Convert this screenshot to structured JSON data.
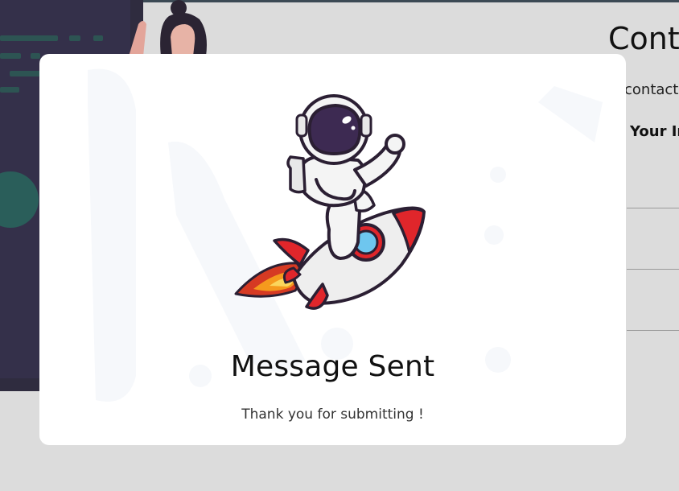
{
  "background": {
    "contact_title": "Conta",
    "contact_subtitle": "contact",
    "contact_section_label": "Your In"
  },
  "modal": {
    "title": "Message Sent",
    "message": "Thank you for submitting !",
    "illustration": "astronaut-on-rocket"
  },
  "colors": {
    "overlay": "#dcdcdc",
    "modal_bg": "#ffffff",
    "rocket_red": "#e0262b",
    "visor": "#3d2a52",
    "window_blue": "#6ec6ef",
    "flame_orange": "#f59a1d"
  }
}
